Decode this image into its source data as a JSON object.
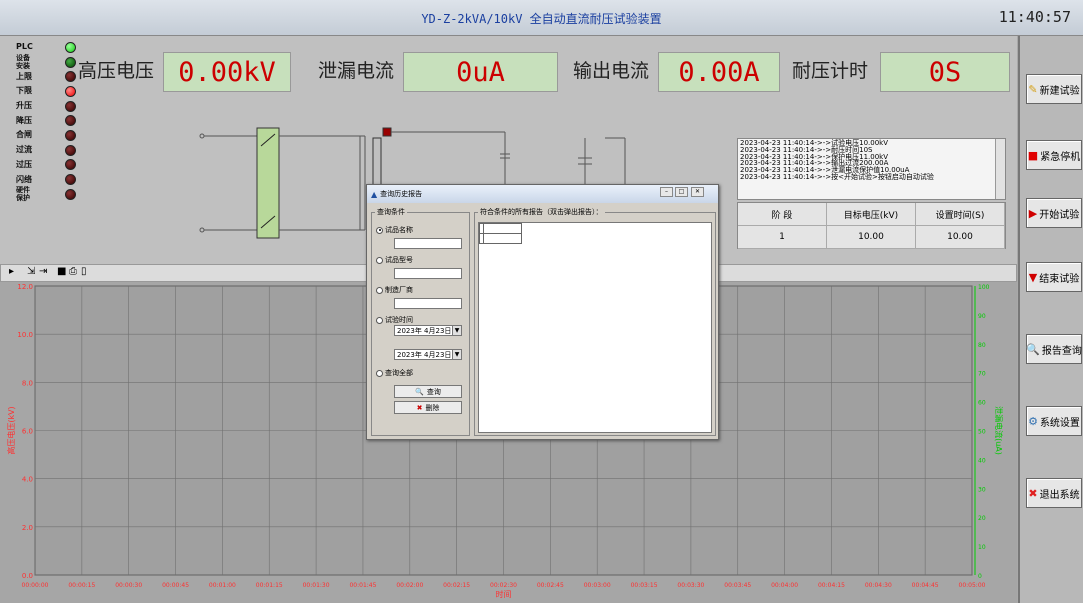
{
  "window": {
    "title": "YD-Z-2kVA/10kV   全自动直流耐压试验装置",
    "clock": "11:40:57"
  },
  "indicators": [
    {
      "label": "PLC",
      "color": "green"
    },
    {
      "label": "设备安装",
      "color": "dkgreen"
    },
    {
      "label": "上限",
      "color": "dkred"
    },
    {
      "label": "下限",
      "color": "red"
    },
    {
      "label": "升压",
      "color": "dkred"
    },
    {
      "label": "降压",
      "color": "dkred"
    },
    {
      "label": "合闸",
      "color": "dkred"
    },
    {
      "label": "过流",
      "color": "dkred"
    },
    {
      "label": "过压",
      "color": "dkred"
    },
    {
      "label": "闪络",
      "color": "dkred"
    },
    {
      "label": "硬件保护",
      "color": "dkred"
    }
  ],
  "meters": {
    "hv_label": "高压电压",
    "hv_value": "0.00kV",
    "leak_label": "泄漏电流",
    "leak_value": "0uA",
    "out_label": "输出电流",
    "out_value": "0.00A",
    "time_label": "耐压计时",
    "time_value": "0S"
  },
  "log": [
    "2023-04-23 11:40:14->->试验电压10.00kV",
    "2023-04-23 11:40:14->->耐压时间10S",
    "2023-04-23 11:40:14->->保护电压11.00kV",
    "2023-04-23 11:40:14->->输出过流200.00A",
    "2023-04-23 11:40:14->->泄漏电流保护值10.00uA",
    "2023-04-23 11:40:14->->按<开始试验>按钮启动自动试验"
  ],
  "stage_table": {
    "headers": [
      "阶 段",
      "目标电压(kV)",
      "设置时间(S)"
    ],
    "row": [
      "1",
      "10.00",
      "10.00"
    ]
  },
  "right_buttons": [
    {
      "label": "新建试验",
      "icon": "new-test-icon",
      "color": "#d4a017"
    },
    {
      "label": "紧急停机",
      "icon": "emergency-stop-icon",
      "color": "#e00000"
    },
    {
      "label": "开始试验",
      "icon": "start-icon",
      "color": "#d00000"
    },
    {
      "label": "结束试验",
      "icon": "end-icon",
      "color": "#d00000"
    },
    {
      "label": "报告查询",
      "icon": "report-query-icon",
      "color": "#3060c0"
    },
    {
      "label": "系统设置",
      "icon": "system-settings-icon",
      "color": "#3070b0"
    },
    {
      "label": "退出系统",
      "icon": "exit-icon",
      "color": "#e02020"
    }
  ],
  "chart_data": {
    "type": "line",
    "xlabel": "时间",
    "ylabel_left": "高压电压(kV)",
    "ylabel_right": "泄漏电流(uA)",
    "y_left_ticks": [
      "12.0",
      "10.0",
      "8.0",
      "6.0",
      "4.0",
      "2.0",
      "0.0"
    ],
    "y_right_ticks": [
      "100",
      "90",
      "80",
      "70",
      "60",
      "50",
      "40",
      "30",
      "20",
      "10",
      "0"
    ],
    "x_ticks": [
      "00:00:00",
      "00:00:15",
      "00:00:30",
      "00:00:45",
      "00:01:00",
      "00:01:15",
      "00:01:30",
      "00:01:45",
      "00:02:00",
      "00:02:15",
      "00:02:30",
      "00:02:45",
      "00:03:00",
      "00:03:15",
      "00:03:30",
      "00:03:45",
      "00:04:00",
      "00:04:15",
      "00:04:30",
      "00:04:45",
      "00:05:00"
    ],
    "ylim_left": [
      0,
      12
    ],
    "ylim_right": [
      0,
      100
    ],
    "grid": true,
    "colors": {
      "left_axis": "#ff3030",
      "right_axis": "#00cc00",
      "grid": "#707070"
    },
    "series": []
  },
  "dialog": {
    "title": "查询历史报告",
    "conditions_label": "查询条件",
    "results_label": "符合条件的所有报告（双击弹出报告）：",
    "radios": [
      "试品名称",
      "试品型号",
      "制造厂商",
      "试验时间",
      "查询全部"
    ],
    "date1": "2023年 4月23日",
    "date2": "2023年 4月23日",
    "query_button": "查询",
    "delete_button": "删除"
  }
}
